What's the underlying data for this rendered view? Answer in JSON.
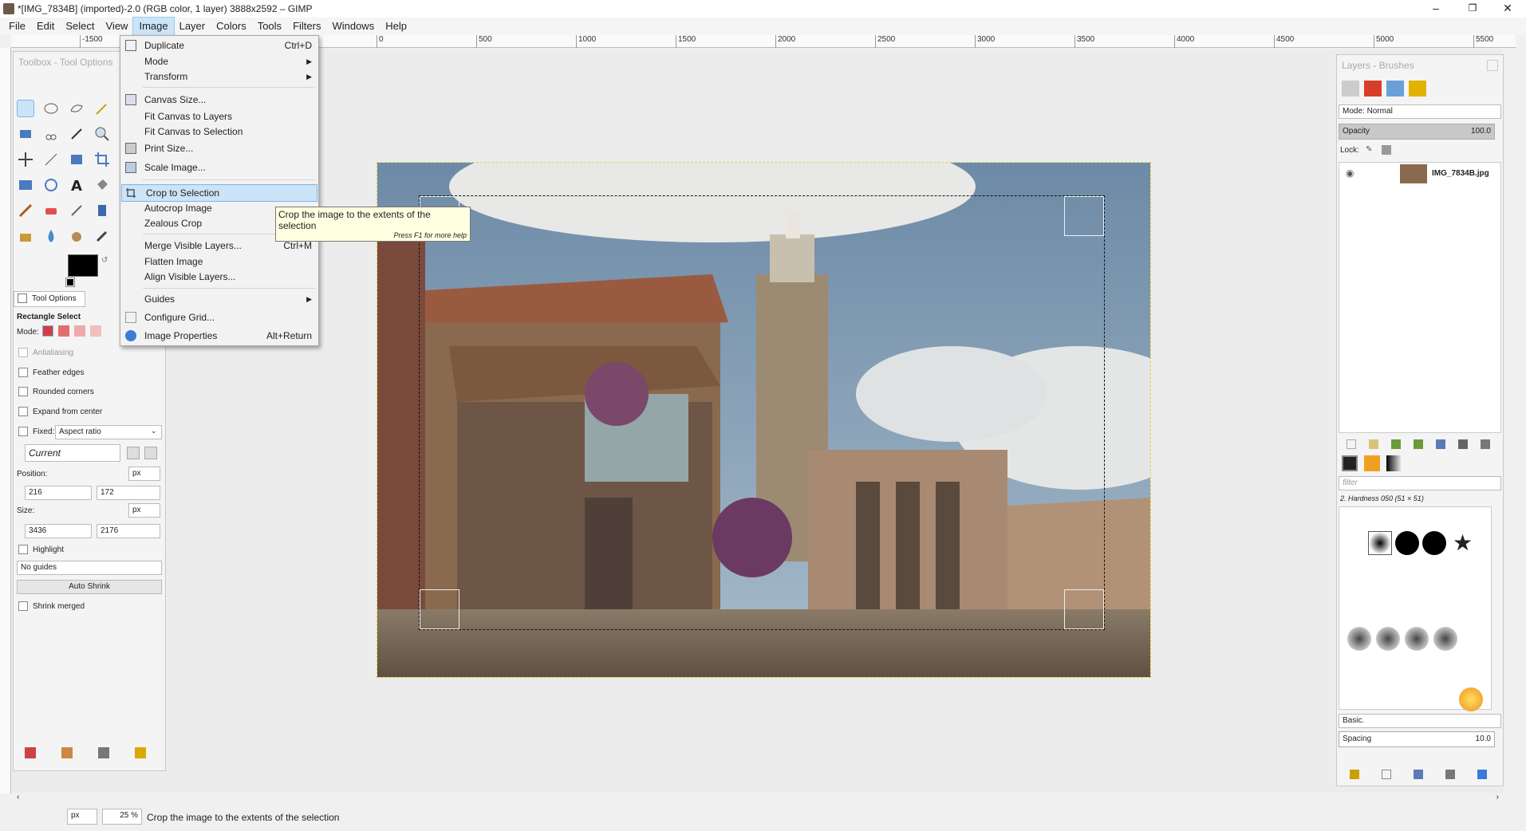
{
  "window": {
    "title": "*[IMG_7834B] (imported)-2.0 (RGB color, 1 layer) 3888x2592 – GIMP",
    "min": "–",
    "max": "❐",
    "close": "✕"
  },
  "menubar": [
    "File",
    "Edit",
    "Select",
    "View",
    "Image",
    "Layer",
    "Colors",
    "Tools",
    "Filters",
    "Windows",
    "Help"
  ],
  "ruler": [
    "-1500",
    "0",
    "500",
    "1000",
    "1500",
    "2000",
    "2500",
    "3000",
    "3500",
    "4000",
    "4500",
    "5000",
    "5500"
  ],
  "image_menu": {
    "items": [
      {
        "label": "Duplicate",
        "accel": "Ctrl+D"
      },
      {
        "label": "Mode",
        "submenu": "▶"
      },
      {
        "label": "Transform",
        "submenu": "▶"
      },
      {
        "label": "Canvas Size..."
      },
      {
        "label": "Fit Canvas to Layers"
      },
      {
        "label": "Fit Canvas to Selection"
      },
      {
        "label": "Print Size..."
      },
      {
        "label": "Scale Image..."
      },
      {
        "label": "Crop to Selection"
      },
      {
        "label": "Autocrop Image"
      },
      {
        "label": "Zealous Crop"
      },
      {
        "label": "Merge Visible Layers...",
        "accel": "Ctrl+M"
      },
      {
        "label": "Flatten Image"
      },
      {
        "label": "Align Visible Layers..."
      },
      {
        "label": "Guides",
        "submenu": "▶"
      },
      {
        "label": "Configure Grid..."
      },
      {
        "label": "Image Properties",
        "accel": "Alt+Return"
      }
    ]
  },
  "tooltip": {
    "text": "Crop the image to the extents of the selection",
    "help": "Press F1 for more help"
  },
  "toolbox": {
    "title": "Toolbox - Tool Options",
    "tab": "Tool Options",
    "tool_name": "Rectangle Select",
    "mode_label": "Mode:",
    "antialiasing": "Antialiasing",
    "feather": "Feather edges",
    "rounded": "Rounded corners",
    "expand": "Expand from center",
    "fixed": "Fixed:",
    "fixed_value": "Aspect ratio",
    "current": "Current",
    "position_label": "Position:",
    "unit": "px",
    "pos_x": "216",
    "pos_y": "172",
    "size_label": "Size:",
    "size_w": "3436",
    "size_h": "2176",
    "highlight": "Highlight",
    "guides": "No guides",
    "auto_shrink": "Auto Shrink",
    "shrink_merged": "Shrink merged"
  },
  "dock": {
    "title": "Layers - Brushes",
    "mode": "Mode: Normal",
    "opacity_label": "Opacity",
    "opacity_value": "100.0",
    "lock_label": "Lock:",
    "layer_name": "IMG_7834B.jpg",
    "filter_placeholder": "filter",
    "brush_name": "2. Hardness 050 (51 × 51)",
    "preset": "Basic.",
    "spacing_label": "Spacing",
    "spacing_value": "10.0"
  },
  "statusbar": {
    "unit": "px",
    "zoom": "25 %",
    "message": "Crop the image to the extents of the selection"
  },
  "colors": {
    "highlight": "#cce4f7",
    "tooltip": "#ffffe1"
  }
}
